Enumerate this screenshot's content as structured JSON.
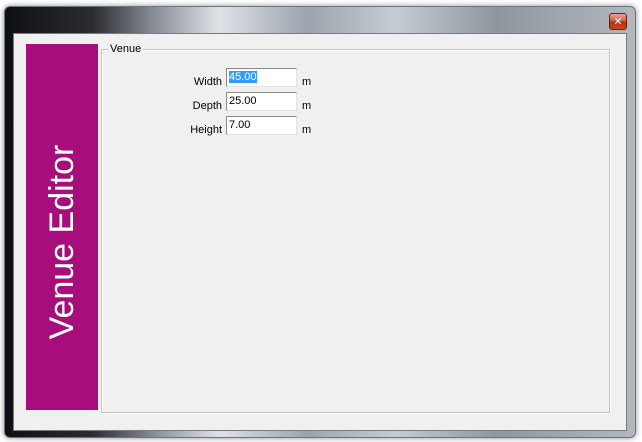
{
  "window": {
    "close_glyph": "✕"
  },
  "banner": {
    "text": "Venue Editor",
    "color": "#a80d7c"
  },
  "group": {
    "legend": "Venue"
  },
  "fields": {
    "width": {
      "label": "Width",
      "value": "45.00",
      "unit": "m"
    },
    "depth": {
      "label": "Depth",
      "value": "25.00",
      "unit": "m"
    },
    "height": {
      "label": "Height",
      "value": "7.00",
      "unit": "m"
    }
  },
  "colors": {
    "selection": "#3399ff",
    "close_button": "#c9481f"
  }
}
